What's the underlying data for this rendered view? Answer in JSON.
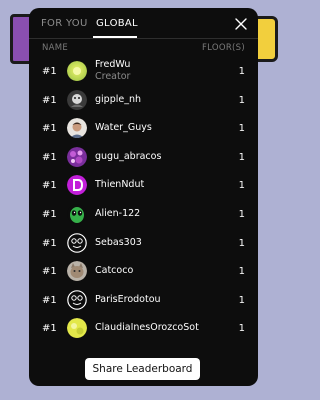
{
  "tabs": {
    "for_you": "FOR YOU",
    "global": "GLOBAL",
    "active": "global"
  },
  "columns": {
    "name": "NAME",
    "floors": "FLOOR(S)"
  },
  "leaderboard": [
    {
      "rank": "#1",
      "name": "FredWu",
      "role": "Creator",
      "floors": "1",
      "avatar": "yellow-green-avatar-icon"
    },
    {
      "rank": "#1",
      "name": "gipple_nh",
      "floors": "1",
      "avatar": "dark-photo-avatar-icon"
    },
    {
      "rank": "#1",
      "name": "Water_Guys",
      "floors": "1",
      "avatar": "person-photo-avatar-icon"
    },
    {
      "rank": "#1",
      "name": "gugu_abracos",
      "floors": "1",
      "avatar": "purple-pattern-avatar-icon"
    },
    {
      "rank": "#1",
      "name": "ThienNdut",
      "floors": "1",
      "avatar": "magenta-letter-avatar-icon"
    },
    {
      "rank": "#1",
      "name": "Alien-122",
      "floors": "1",
      "avatar": "green-alien-avatar-icon"
    },
    {
      "rank": "#1",
      "name": "Sebas303",
      "floors": "1",
      "avatar": "default-face-avatar-icon"
    },
    {
      "rank": "#1",
      "name": "Catcoco",
      "floors": "1",
      "avatar": "cat-photo-avatar-icon"
    },
    {
      "rank": "#1",
      "name": "ParisErodotou",
      "floors": "1",
      "avatar": "default-face-avatar-icon"
    },
    {
      "rank": "#1",
      "name": "ClaudiaInesOrozcoSot",
      "floors": "1",
      "avatar": "yellow-blob-avatar-icon"
    }
  ],
  "share_button": "Share Leaderboard",
  "colors": {
    "background": "#aeb1d3",
    "modal": "#0d0d0d",
    "button": "#ffffff"
  }
}
